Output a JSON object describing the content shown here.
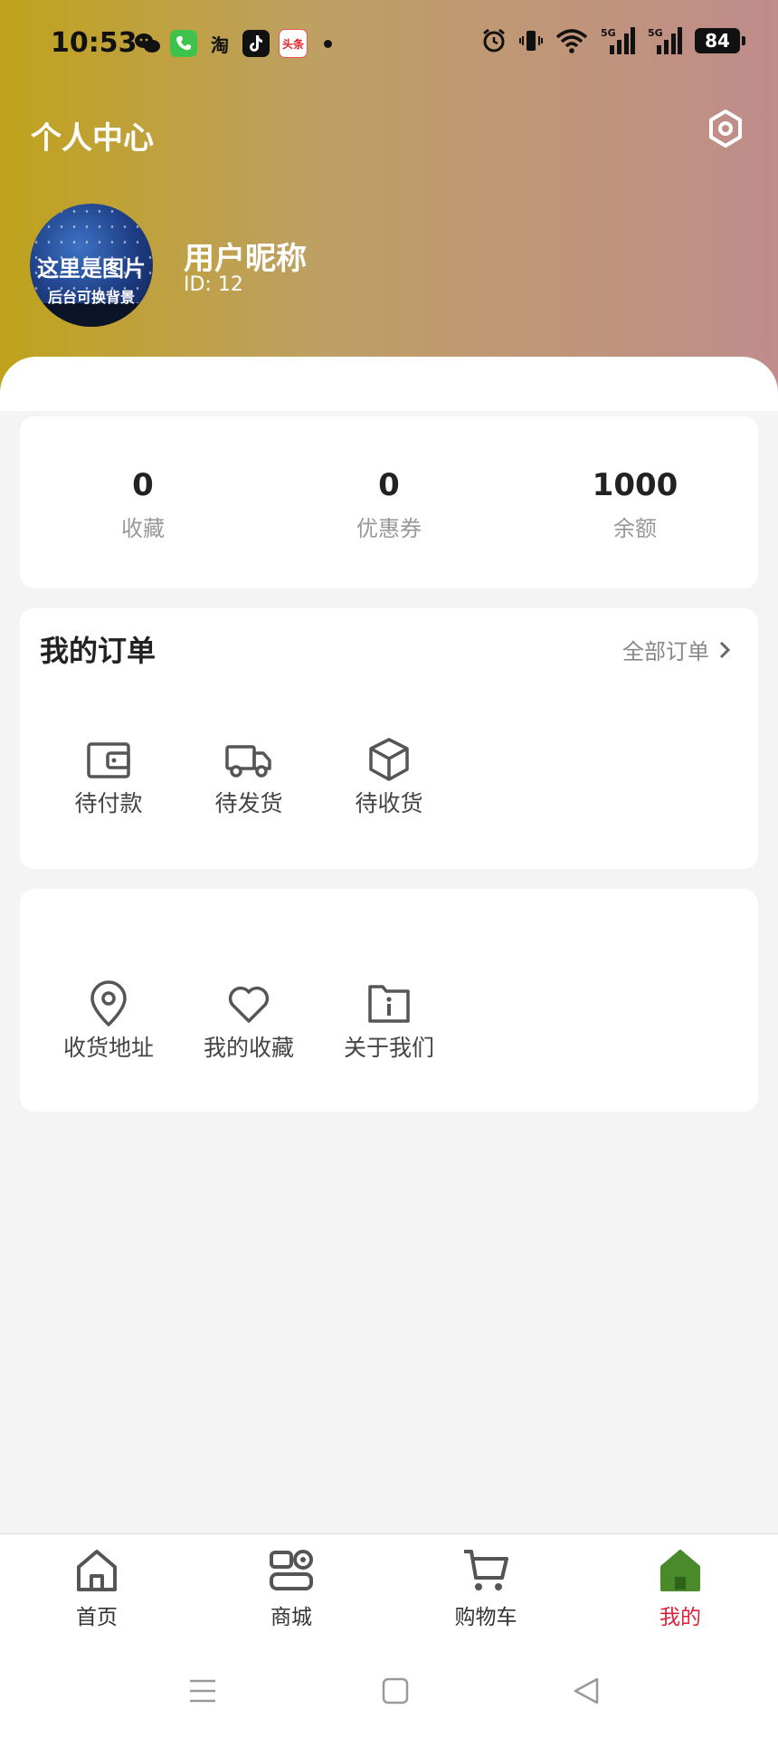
{
  "status_bar": {
    "time": "10:53",
    "battery": "84",
    "apps": [
      "wechat",
      "phone",
      "淘",
      "douyin",
      "头条"
    ]
  },
  "header": {
    "title": "个人中心",
    "avatar_text_line1": "这里是图片",
    "avatar_text_line2": "后台可换背景",
    "nickname": "用户昵称",
    "user_id": "ID: 12"
  },
  "stats": [
    {
      "value": "0",
      "label": "收藏"
    },
    {
      "value": "0",
      "label": "优惠券"
    },
    {
      "value": "1000",
      "label": "余额"
    }
  ],
  "orders": {
    "title": "我的订单",
    "all_label": "全部订单",
    "items": [
      {
        "label": "待付款",
        "icon": "wallet-icon"
      },
      {
        "label": "待发货",
        "icon": "truck-icon"
      },
      {
        "label": "待收货",
        "icon": "box-icon"
      }
    ]
  },
  "services": {
    "items": [
      {
        "label": "收货地址",
        "icon": "location-pin-icon"
      },
      {
        "label": "我的收藏",
        "icon": "heart-icon"
      },
      {
        "label": "关于我们",
        "icon": "info-folder-icon"
      }
    ]
  },
  "tabbar": {
    "items": [
      {
        "label": "首页",
        "icon": "home-icon",
        "active": false
      },
      {
        "label": "商城",
        "icon": "shop-icon",
        "active": false
      },
      {
        "label": "购物车",
        "icon": "cart-icon",
        "active": false
      },
      {
        "label": "我的",
        "icon": "profile-home-icon",
        "active": true
      }
    ]
  },
  "colors": {
    "header_gradient_start": "#c0a21c",
    "header_gradient_end": "#c08c8c",
    "active_tab": "#e0203a",
    "active_icon": "#4a8a2a"
  }
}
